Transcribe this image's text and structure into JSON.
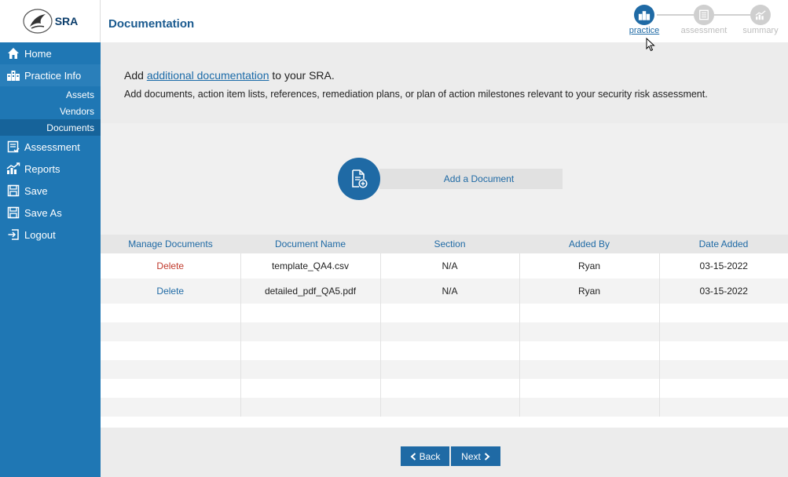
{
  "app": {
    "logo_text": "SRA"
  },
  "sidebar": {
    "items": [
      {
        "label": "Home",
        "icon": "home-icon"
      },
      {
        "label": "Practice Info",
        "icon": "building-icon"
      },
      {
        "label": "Assessment",
        "icon": "checklist-icon"
      },
      {
        "label": "Reports",
        "icon": "chart-icon"
      },
      {
        "label": "Save",
        "icon": "save-icon"
      },
      {
        "label": "Save As",
        "icon": "save-as-icon"
      },
      {
        "label": "Logout",
        "icon": "logout-icon"
      }
    ],
    "sub_items": [
      {
        "label": "Assets"
      },
      {
        "label": "Vendors"
      },
      {
        "label": "Documents"
      }
    ],
    "active_sub": "Documents"
  },
  "header": {
    "title": "Documentation"
  },
  "stepper": {
    "steps": [
      {
        "label": "practice",
        "state": "active"
      },
      {
        "label": "assessment",
        "state": "inactive"
      },
      {
        "label": "summary",
        "state": "inactive"
      }
    ]
  },
  "banner": {
    "line1_prefix": "Add ",
    "line1_link": "additional documentation",
    "line1_suffix": " to your SRA.",
    "line2": "Add documents, action item lists, references, remediation plans, or plan of action milestones relevant to your security risk assessment."
  },
  "add_document": {
    "label": "Add a Document"
  },
  "table": {
    "columns": [
      "Manage Documents",
      "Document Name",
      "Section",
      "Added By",
      "Date Added"
    ],
    "rows": [
      {
        "action": "Delete",
        "name": "template_QA4.csv",
        "section": "N/A",
        "added_by": "Ryan",
        "date": "03-15-2022"
      },
      {
        "action": "Delete",
        "name": "detailed_pdf_QA5.pdf",
        "section": "N/A",
        "added_by": "Ryan",
        "date": "03-15-2022"
      }
    ]
  },
  "footer": {
    "back_label": "Back",
    "next_label": "Next"
  },
  "colors": {
    "sidebar": "#1f77b4",
    "accent": "#1f6aa5",
    "delete_red": "#c0392b"
  }
}
